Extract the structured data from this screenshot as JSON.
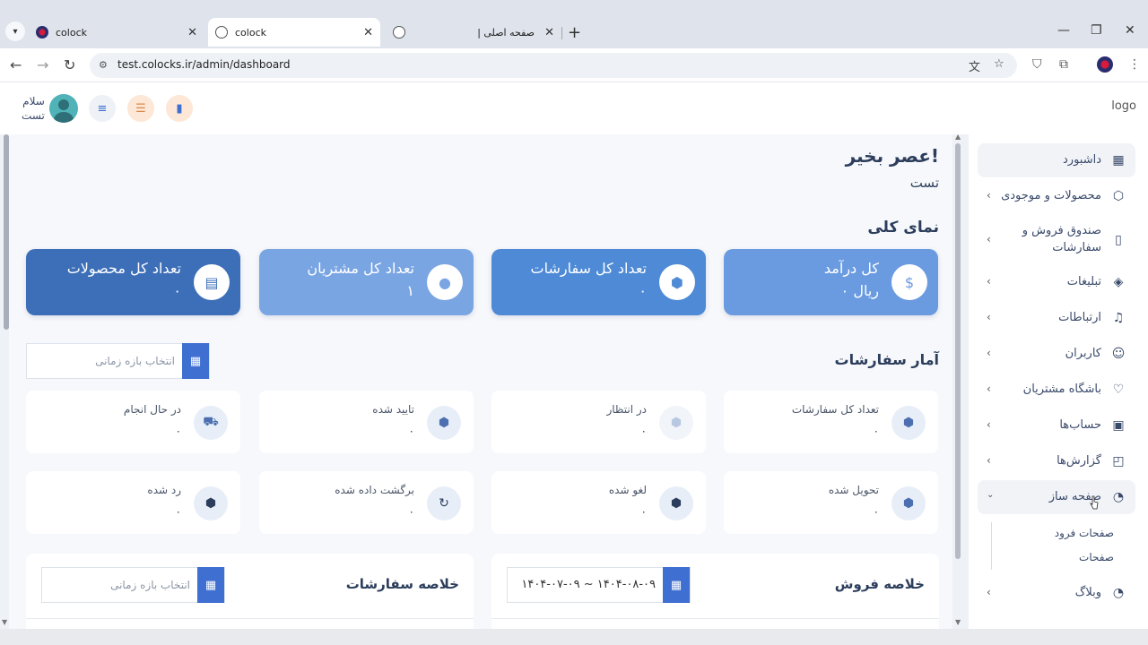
{
  "browser": {
    "tabs": [
      {
        "title": "colock",
        "active": false
      },
      {
        "title": "colock",
        "active": true
      },
      {
        "title": "| صفحه اصلی",
        "active": false
      }
    ],
    "url": "test.colocks.ir/admin/dashboard",
    "new_tab": "+",
    "window_controls": {
      "minimize": "—",
      "maximize": "❐",
      "close": "✕"
    }
  },
  "header": {
    "greeting_line1": "سلام",
    "greeting_line2": "تست",
    "logo_alt": "logo"
  },
  "main": {
    "greeting": "عصر بخیر!",
    "user_name": "تست",
    "overview_title": "نمای کلی",
    "stats": [
      {
        "label": "کل درآمد",
        "value": "۰ ریال",
        "icon": "dollar-icon",
        "color": "#6a9be0"
      },
      {
        "label": "تعداد کل سفارشات",
        "value": "۰",
        "icon": "box-icon",
        "color": "#4e8ad6"
      },
      {
        "label": "تعداد کل مشتریان",
        "value": "۱",
        "icon": "users-icon",
        "color": "#7aa5e3"
      },
      {
        "label": "تعداد کل محصولات",
        "value": "۰",
        "icon": "document-icon",
        "color": "#3d6fb8"
      }
    ],
    "orders_stats_title": "آمار سفارشات",
    "date_range_placeholder": "انتخاب بازه زمانی",
    "order_cards_row1": [
      {
        "label": "تعداد کل سفارشات",
        "value": "۰",
        "icon": "box-icon"
      },
      {
        "label": "در انتظار",
        "value": "۰",
        "icon": "clock-box-icon"
      },
      {
        "label": "تایید شده",
        "value": "۰",
        "icon": "check-box-icon"
      },
      {
        "label": "در حال انجام",
        "value": "۰",
        "icon": "truck-icon"
      }
    ],
    "order_cards_row2": [
      {
        "label": "تحویل شده",
        "value": "۰",
        "icon": "delivered-box-icon"
      },
      {
        "label": "لغو شده",
        "value": "۰",
        "icon": "cancel-box-icon"
      },
      {
        "label": "برگشت داده شده",
        "value": "۰",
        "icon": "return-icon"
      },
      {
        "label": "رد شده",
        "value": "۰",
        "icon": "rejected-box-icon"
      }
    ],
    "sales_summary_title": "خلاصه فروش",
    "sales_date_value": "۱۴۰۴-۰۷-۰۹ ~ ۱۴۰۴-۰۸-۰۹",
    "orders_summary_title": "خلاصه سفارشات",
    "orders_summary_placeholder": "انتخاب بازه زمانی"
  },
  "sidebar": {
    "items": [
      {
        "label": "داشبورد",
        "icon": "dashboard-icon",
        "has_chevron": false,
        "active": true
      },
      {
        "label": "محصولات و موجودی",
        "icon": "box-icon",
        "has_chevron": true
      },
      {
        "label": "صندوق فروش و سفارشات",
        "label_line1": "صندوق فروش و",
        "label_line2": "سفارشات",
        "icon": "receipt-icon",
        "has_chevron": true
      },
      {
        "label": "تبلیغات",
        "icon": "tag-icon",
        "has_chevron": true
      },
      {
        "label": "ارتباطات",
        "icon": "bell-icon",
        "has_chevron": true
      },
      {
        "label": "کاربران",
        "icon": "users-icon",
        "has_chevron": true
      },
      {
        "label": "باشگاه مشتریان",
        "icon": "heart-icon",
        "has_chevron": true
      },
      {
        "label": "حساب‌ها",
        "icon": "wallet-icon",
        "has_chevron": true
      },
      {
        "label": "گزارش‌ها",
        "icon": "chart-icon",
        "has_chevron": true
      },
      {
        "label": "صفحه ساز",
        "icon": "page-builder-icon",
        "has_chevron": true,
        "expanded": true
      },
      {
        "label": "وبلاگ",
        "icon": "blog-icon",
        "has_chevron": true
      }
    ],
    "page_builder_subitems": [
      "صفحات فرود",
      "صفحات"
    ]
  }
}
